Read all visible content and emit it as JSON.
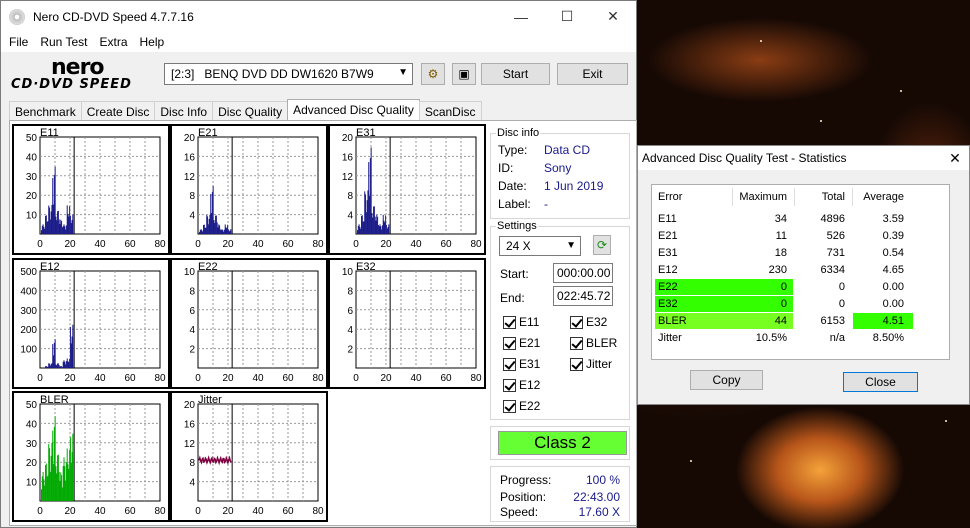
{
  "window": {
    "title": "Nero CD-DVD Speed 4.7.7.16"
  },
  "menu": [
    "File",
    "Run Test",
    "Extra",
    "Help"
  ],
  "logo": {
    "top": "nero",
    "bottom": "CD·DVD SPEED"
  },
  "drive": {
    "selected": "[2:3]   BENQ DVD DD DW1620 B7W9"
  },
  "buttons": {
    "start": "Start",
    "exit": "Exit"
  },
  "tabs": [
    "Benchmark",
    "Create Disc",
    "Disc Info",
    "Disc Quality",
    "Advanced Disc Quality",
    "ScanDisc"
  ],
  "active_tab": "Advanced Disc Quality",
  "disc_info": {
    "header": "Disc info",
    "type_label": "Type:",
    "type": "Data CD",
    "id_label": "ID:",
    "id": "Sony",
    "date_label": "Date:",
    "date": "1 Jun 2019",
    "label_label": "Label:",
    "label": "-"
  },
  "settings": {
    "header": "Settings",
    "speed": "24 X",
    "start_label": "Start:",
    "start": "000:00.00",
    "end_label": "End:",
    "end": "022:45.72",
    "checks_left": [
      "E11",
      "E21",
      "E31",
      "E12",
      "E22"
    ],
    "checks_right": [
      "E32",
      "BLER",
      "Jitter"
    ]
  },
  "class_badge": "Class 2",
  "progress": {
    "progress_label": "Progress:",
    "progress": "100 %",
    "position_label": "Position:",
    "position": "22:43.00",
    "speed_label": "Speed:",
    "speed": "17.60 X"
  },
  "colors": {
    "bar_dark": "#1a1a8a",
    "bar_green": "#00aa00",
    "jitter": "#800040",
    "class_green": "#66ff33"
  },
  "chart_data": [
    {
      "type": "bar",
      "title": "E11",
      "yticks": [
        "50",
        "40",
        "30",
        "20",
        "10"
      ],
      "xticks": [
        "0",
        "20",
        "40",
        "60",
        "80"
      ],
      "ylim": [
        0,
        50
      ],
      "xlim": [
        0,
        80
      ]
    },
    {
      "type": "bar",
      "title": "E21",
      "yticks": [
        "20",
        "16",
        "12",
        "8",
        "4"
      ],
      "xticks": [
        "0",
        "20",
        "40",
        "60",
        "80"
      ],
      "ylim": [
        0,
        20
      ],
      "xlim": [
        0,
        80
      ]
    },
    {
      "type": "bar",
      "title": "E31",
      "yticks": [
        "20",
        "16",
        "12",
        "8",
        "4"
      ],
      "xticks": [
        "0",
        "20",
        "40",
        "60",
        "80"
      ],
      "ylim": [
        0,
        20
      ],
      "xlim": [
        0,
        80
      ]
    },
    {
      "type": "bar",
      "title": "E12",
      "yticks": [
        "500",
        "400",
        "300",
        "200",
        "100"
      ],
      "xticks": [
        "0",
        "20",
        "40",
        "60",
        "80"
      ],
      "ylim": [
        0,
        500
      ],
      "xlim": [
        0,
        80
      ]
    },
    {
      "type": "bar",
      "title": "E22",
      "yticks": [
        "10",
        "8",
        "6",
        "4",
        "2"
      ],
      "xticks": [
        "0",
        "20",
        "40",
        "60",
        "80"
      ],
      "ylim": [
        0,
        10
      ],
      "xlim": [
        0,
        80
      ]
    },
    {
      "type": "bar",
      "title": "E32",
      "yticks": [
        "10",
        "8",
        "6",
        "4",
        "2"
      ],
      "xticks": [
        "0",
        "20",
        "40",
        "60",
        "80"
      ],
      "ylim": [
        0,
        10
      ],
      "xlim": [
        0,
        80
      ]
    },
    {
      "type": "bar",
      "title": "BLER",
      "yticks": [
        "50",
        "40",
        "30",
        "20",
        "10"
      ],
      "xticks": [
        "0",
        "20",
        "40",
        "60",
        "80"
      ],
      "ylim": [
        0,
        50
      ],
      "xlim": [
        0,
        80
      ]
    },
    {
      "type": "line",
      "title": "Jitter",
      "yticks": [
        "20",
        "16",
        "12",
        "8",
        "4"
      ],
      "xticks": [
        "0",
        "20",
        "40",
        "60",
        "80"
      ],
      "ylim": [
        0,
        20
      ],
      "xlim": [
        0,
        80
      ]
    }
  ],
  "stats_dialog": {
    "title": "Advanced Disc Quality Test - Statistics",
    "headers": [
      "Error",
      "Maximum",
      "Total",
      "Average"
    ],
    "rows": [
      [
        "E11",
        "34",
        "4896",
        "3.59"
      ],
      [
        "E21",
        "11",
        "526",
        "0.39"
      ],
      [
        "E31",
        "18",
        "731",
        "0.54"
      ],
      [
        "E12",
        "230",
        "6334",
        "4.65"
      ],
      [
        "E22",
        "0",
        "0",
        "0.00"
      ],
      [
        "E32",
        "0",
        "0",
        "0.00"
      ],
      [
        "BLER",
        "44",
        "6153",
        "4.51"
      ],
      [
        "Jitter",
        "10.5%",
        "n/a",
        "8.50%"
      ]
    ],
    "copy": "Copy",
    "close": "Close"
  }
}
